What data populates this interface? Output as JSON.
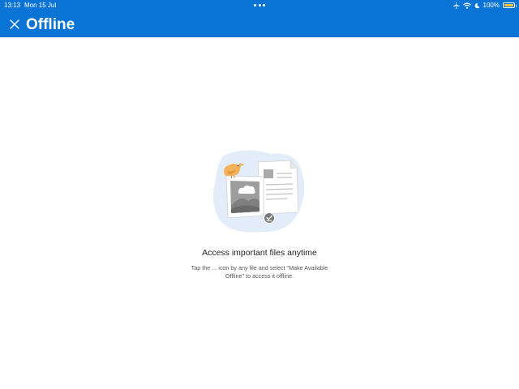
{
  "status_bar": {
    "time": "13:13",
    "date": "Mon 15 Jul",
    "battery_percent": "100%",
    "battery_level": 1.0,
    "icons": [
      "airplane-icon",
      "wifi-icon",
      "moon-icon",
      "battery-icon"
    ]
  },
  "header": {
    "title": "Offline",
    "close_icon": "close-icon",
    "background_color": "#0a74d6"
  },
  "empty_state": {
    "title": "Access important files anytime",
    "description": "Tap the ... icon by any file and select \"Make Available Offline\" to access it offline."
  }
}
